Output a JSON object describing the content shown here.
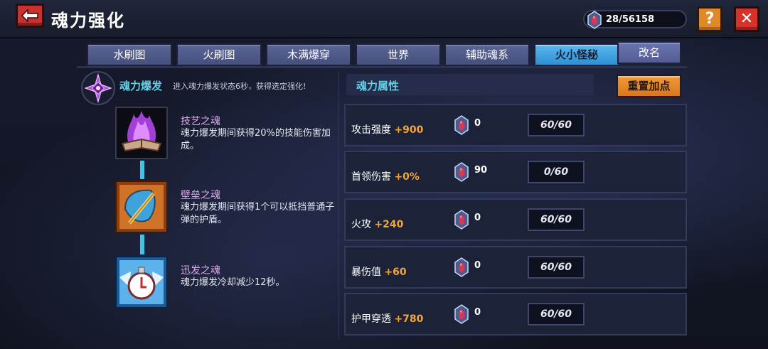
{
  "header": {
    "title": "魂力强化",
    "currency": "28/56158",
    "help_label": "?",
    "close_label": "✕"
  },
  "tabs": [
    {
      "label": "水刷图",
      "active": false
    },
    {
      "label": "火刷图",
      "active": false
    },
    {
      "label": "木满爆穿",
      "active": false
    },
    {
      "label": "世界",
      "active": false
    },
    {
      "label": "辅助魂系",
      "active": false
    },
    {
      "label": "火小怪秘",
      "active": true
    }
  ],
  "rename_label": "改名",
  "burst": {
    "title": "魂力爆发",
    "description": "进入魂力爆发状态6秒，获得选定强化!"
  },
  "souls": [
    {
      "name": "技艺之魂",
      "description": "魂力爆发期间获得20%的技能伤害加成。",
      "icon": "purple-flame-book-icon"
    },
    {
      "name": "壁垒之魂",
      "description": "魂力爆发期间获得1个可以抵挡普通子弹的护盾。",
      "icon": "shield-axe-icon"
    },
    {
      "name": "迅发之魂",
      "description": "魂力爆发冷却减少12秒。",
      "icon": "winged-stopwatch-icon"
    }
  ],
  "attributes": {
    "header": "魂力属性",
    "reset_label": "重置加点",
    "rows": [
      {
        "label": "攻击强度",
        "bonus": "+900",
        "cost": "0",
        "level": "60/60"
      },
      {
        "label": "首领伤害",
        "bonus": "+0%",
        "cost": "90",
        "level": "0/60"
      },
      {
        "label": "火攻",
        "bonus": "+240",
        "cost": "0",
        "level": "60/60"
      },
      {
        "label": "暴伤值",
        "bonus": "+60",
        "cost": "0",
        "level": "60/60"
      },
      {
        "label": "护甲穿透",
        "bonus": "+780",
        "cost": "0",
        "level": "60/60"
      }
    ]
  },
  "colors": {
    "accent_cyan": "#5fd0e6",
    "bonus_orange": "#f0a63a",
    "active_tab": "#3aa3e0",
    "close_red": "#d7312c",
    "help_orange": "#e0892b"
  }
}
